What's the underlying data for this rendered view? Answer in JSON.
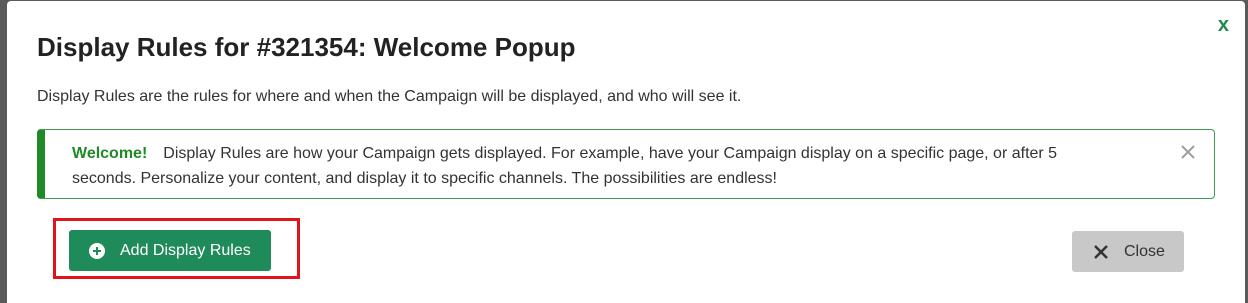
{
  "modal": {
    "close_glyph": "x",
    "title": "Display Rules for #321354: Welcome Popup",
    "description": "Display Rules are the rules for where and when the Campaign will be displayed, and who will see it."
  },
  "alert": {
    "strong": "Welcome!",
    "text": "Display Rules are how your Campaign gets displayed. For example, have your Campaign display on a specific page, or after 5 seconds. Personalize your content, and display it to specific channels. The possibilities are endless!",
    "close_icon": "close-icon"
  },
  "buttons": {
    "add_rules_label": "Add Display Rules",
    "add_rules_icon": "plus-circle-icon",
    "close_label": "Close",
    "close_icon": "x-icon"
  },
  "colors": {
    "primary": "#1f8a5a",
    "success_border": "#1f8a27",
    "highlight": "#e0141c",
    "secondary_button": "#c8c8c8"
  }
}
